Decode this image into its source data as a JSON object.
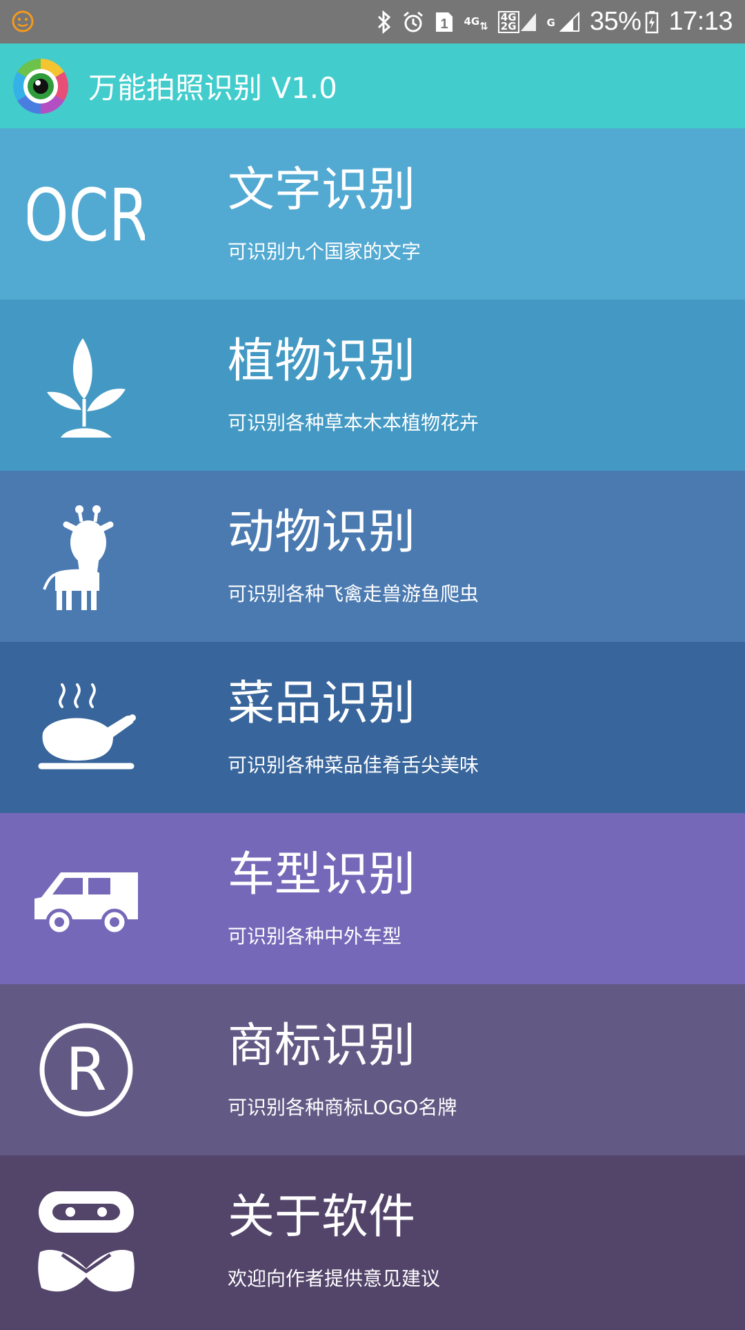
{
  "status_bar": {
    "battery": "35%",
    "time": "17:13",
    "net_4g": "4G",
    "net_4g2g_top": "4G",
    "net_4g2g_bottom": "2G",
    "net_g": "G",
    "sim_slot": "1"
  },
  "app_bar": {
    "title": "万能拍照识别 V1.0",
    "accent_color": "#42cccc"
  },
  "menu": {
    "items": [
      {
        "title": "文字识别",
        "subtitle": "可识别九个国家的文字",
        "icon": "ocr-icon",
        "icon_text": "OCR",
        "color": "#52a9d2"
      },
      {
        "title": "植物识别",
        "subtitle": "可识别各种草本木本植物花卉",
        "icon": "plant-icon",
        "color": "#4399c3"
      },
      {
        "title": "动物识别",
        "subtitle": "可识别各种飞禽走兽游鱼爬虫",
        "icon": "giraffe-icon",
        "color": "#4b7ab1"
      },
      {
        "title": "菜品识别",
        "subtitle": "可识别各种菜品佳肴舌尖美味",
        "icon": "roast-chicken-icon",
        "color": "#38659b"
      },
      {
        "title": "车型识别",
        "subtitle": "可识别各种中外车型",
        "icon": "car-icon",
        "color": "#7668b8"
      },
      {
        "title": "商标识别",
        "subtitle": "可识别各种商标LOGO名牌",
        "icon": "registered-trademark-icon",
        "icon_text": "R",
        "color": "#625a84"
      },
      {
        "title": "关于软件",
        "subtitle": "欢迎向作者提供意见建议",
        "icon": "robot-icon",
        "color": "#53446a"
      }
    ]
  }
}
